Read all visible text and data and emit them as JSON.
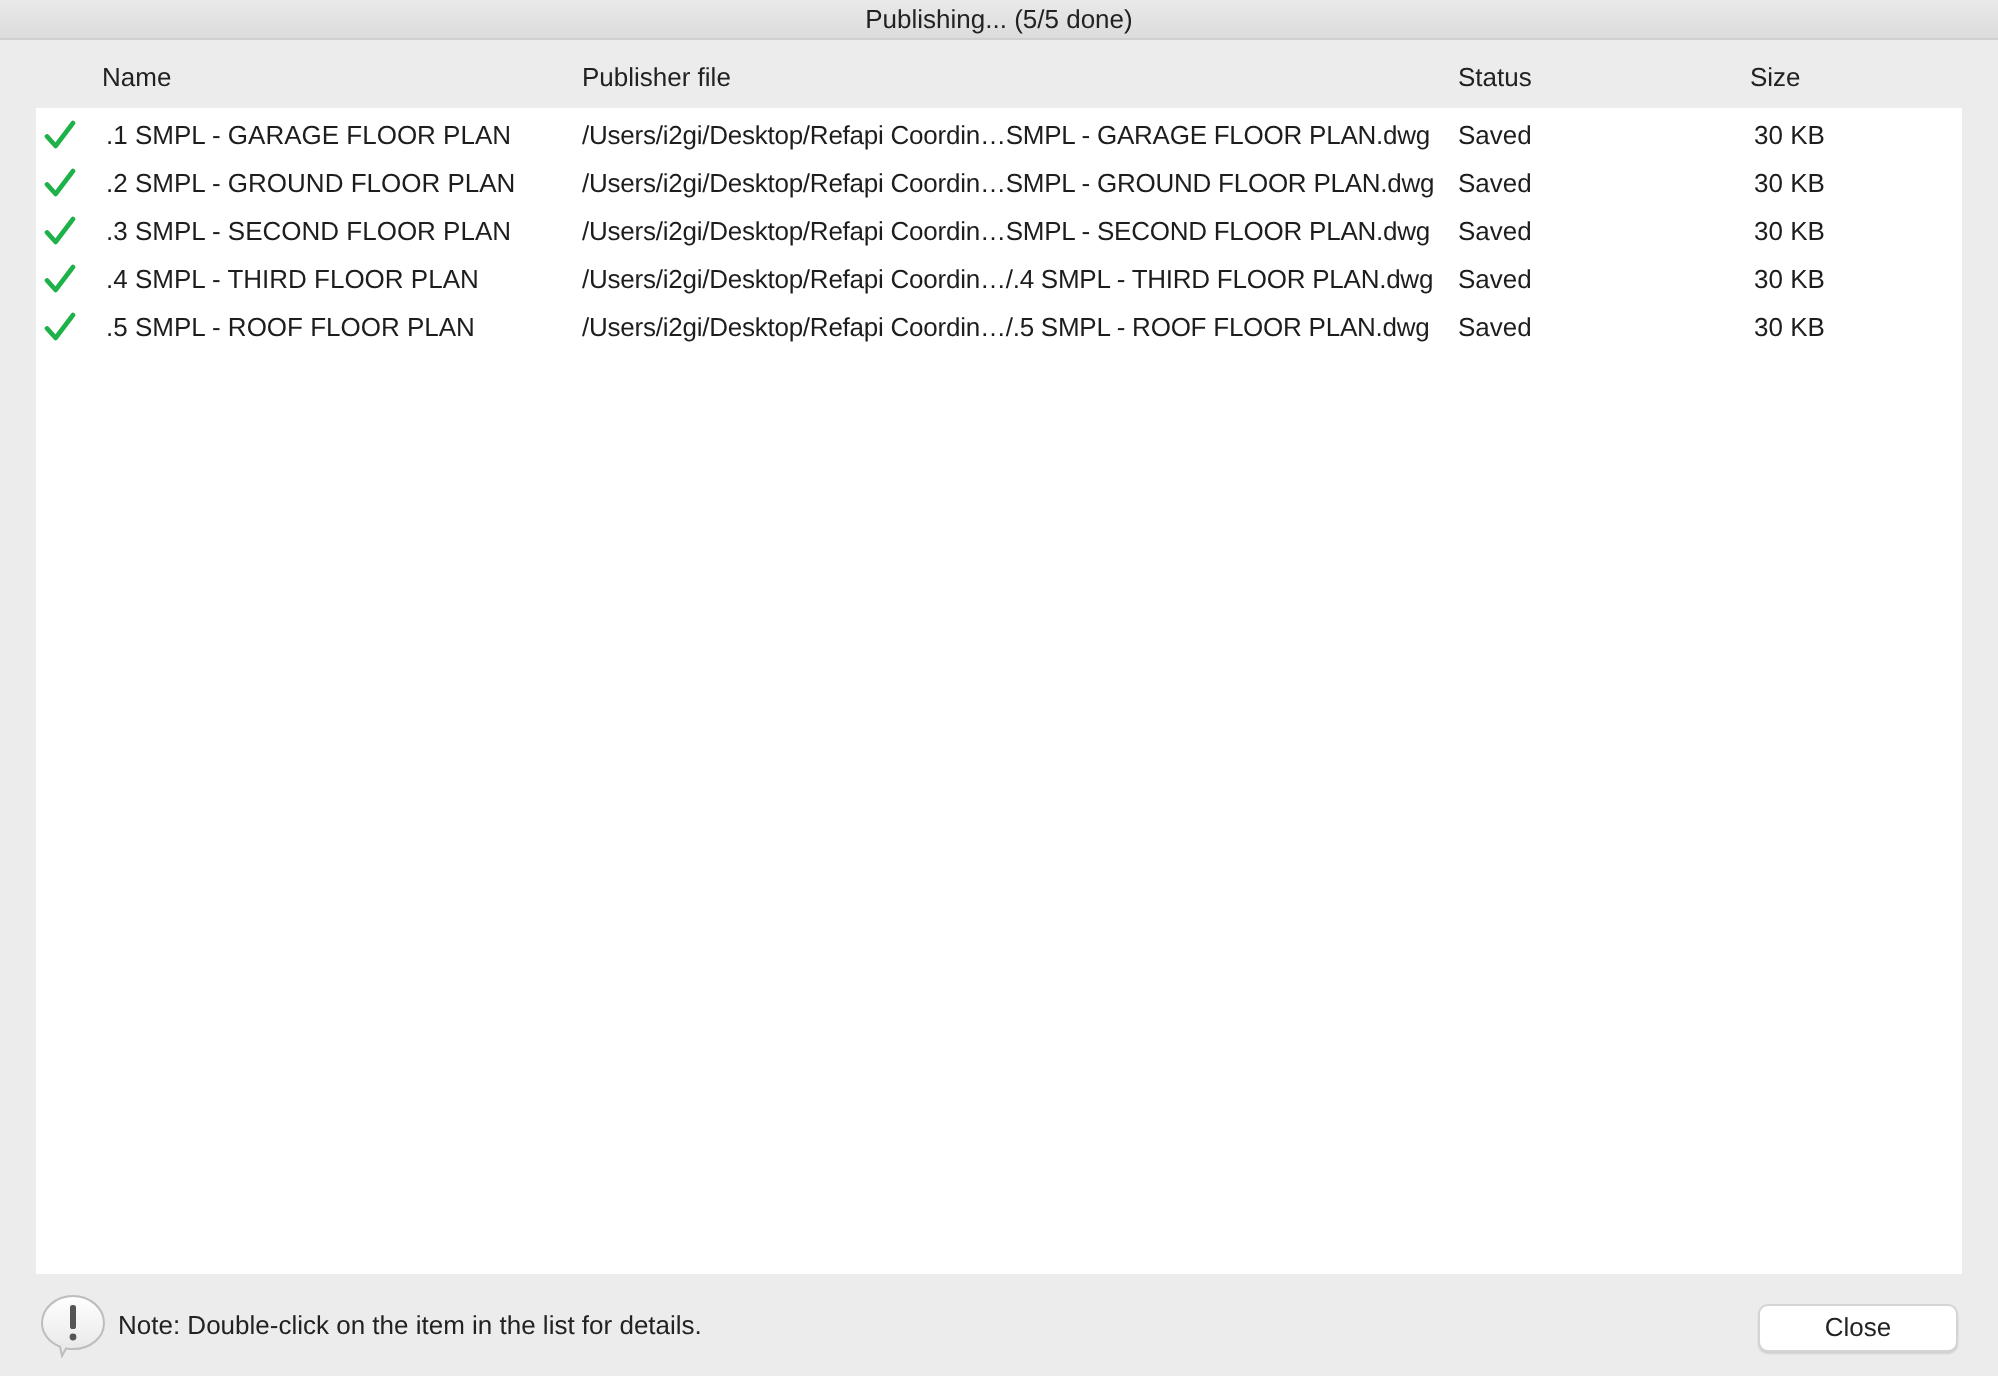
{
  "window": {
    "title": "Publishing... (5/5 done)"
  },
  "table": {
    "columns": [
      "Name",
      "Publisher file",
      "Status",
      "Size"
    ],
    "rows": [
      {
        "done": true,
        "name": ".1 SMPL - GARAGE FLOOR PLAN",
        "file": "/Users/i2gi/Desktop/Refapi Coordin…SMPL - GARAGE FLOOR PLAN.dwg",
        "status": "Saved",
        "size": "30 KB"
      },
      {
        "done": true,
        "name": ".2 SMPL - GROUND FLOOR PLAN",
        "file": "/Users/i2gi/Desktop/Refapi Coordin…SMPL - GROUND FLOOR PLAN.dwg",
        "status": "Saved",
        "size": "30 KB"
      },
      {
        "done": true,
        "name": ".3 SMPL - SECOND FLOOR PLAN",
        "file": "/Users/i2gi/Desktop/Refapi Coordin…SMPL - SECOND FLOOR PLAN.dwg",
        "status": "Saved",
        "size": "30 KB"
      },
      {
        "done": true,
        "name": ".4 SMPL - THIRD FLOOR PLAN",
        "file": "/Users/i2gi/Desktop/Refapi Coordin…/.4 SMPL - THIRD FLOOR PLAN.dwg",
        "status": "Saved",
        "size": "30 KB"
      },
      {
        "done": true,
        "name": ".5 SMPL - ROOF FLOOR PLAN",
        "file": "/Users/i2gi/Desktop/Refapi Coordin…/.5 SMPL - ROOF FLOOR PLAN.dwg",
        "status": "Saved",
        "size": "30 KB"
      }
    ]
  },
  "footer": {
    "note": "Note: Double-click on the item in the list for details.",
    "buttons": [
      "Close"
    ]
  }
}
